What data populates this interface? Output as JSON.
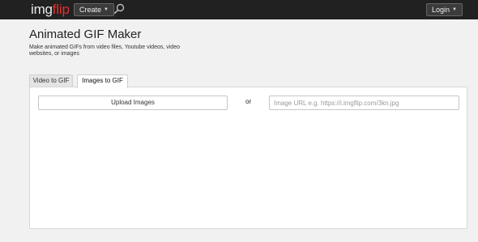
{
  "header": {
    "logo_part1": "img",
    "logo_part2": "flip",
    "create_label": "Create",
    "login_label": "Login",
    "colors": {
      "bar": "#212121",
      "logo_img": "#e9e9e9",
      "logo_flip": "#e0302e"
    },
    "icons": [
      "search-icon",
      "chevron-down-icon"
    ]
  },
  "main": {
    "title": "Animated GIF Maker",
    "description": "Make animated GIFs from video files, Youtube videos, video websites, or images",
    "tabs": [
      {
        "label": "Video to GIF",
        "active": false
      },
      {
        "label": "Images to GIF",
        "active": true
      }
    ],
    "upload_label": "Upload Images",
    "or_label": "or",
    "url_placeholder": "Image URL e.g. https://i.imgflip.com/3kn.jpg",
    "url_value": ""
  }
}
